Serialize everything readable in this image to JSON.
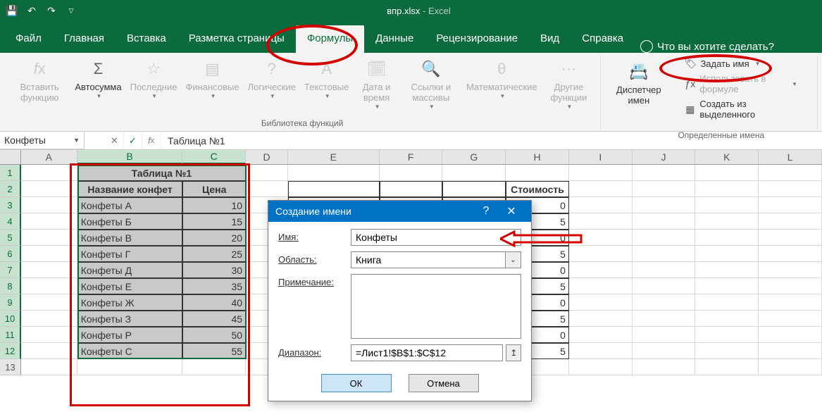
{
  "titlebar": {
    "filename": "впр.xlsx",
    "app": "Excel"
  },
  "tabs": {
    "items": [
      "Файл",
      "Главная",
      "Вставка",
      "Разметка страницы",
      "Формулы",
      "Данные",
      "Рецензирование",
      "Вид",
      "Справка"
    ],
    "active_index": 4,
    "search_placeholder": "Что вы хотите сделать?"
  },
  "ribbon": {
    "library_label": "Библиотека функций",
    "buttons": {
      "insert_fn": "Вставить функцию",
      "autosum": "Автосумма",
      "recent": "Последние",
      "financial": "Финансовые",
      "logical": "Логические",
      "text": "Текстовые",
      "datetime": "Дата и время",
      "lookup": "Ссылки и массивы",
      "math": "Математические",
      "other": "Другие функции",
      "name_mgr": "Диспетчер имен"
    },
    "names": {
      "define": "Задать имя",
      "use": "Использовать в формуле",
      "create": "Создать из выделенного",
      "group_label": "Определенные имена"
    }
  },
  "formula_bar": {
    "name": "Конфеты",
    "formula": "Таблица №1"
  },
  "columns": [
    "A",
    "B",
    "C",
    "D",
    "E",
    "F",
    "G",
    "H",
    "I",
    "J",
    "K",
    "L"
  ],
  "rows": [
    1,
    2,
    3,
    4,
    5,
    6,
    7,
    8,
    9,
    10,
    11,
    12,
    13
  ],
  "table1": {
    "title": "Таблица №1",
    "headers": [
      "Название конфет",
      "Цена"
    ],
    "rows": [
      [
        "Конфеты А",
        10
      ],
      [
        "Конфеты Б",
        15
      ],
      [
        "Конфеты В",
        20
      ],
      [
        "Конфеты Г",
        25
      ],
      [
        "Конфеты Д",
        30
      ],
      [
        "Конфеты Е",
        35
      ],
      [
        "Конфеты Ж",
        40
      ],
      [
        "Конфеты З",
        45
      ],
      [
        "Конфеты Р",
        50
      ],
      [
        "Конфеты С",
        55
      ]
    ]
  },
  "table2": {
    "headers": [
      "",
      "",
      "",
      "Стоимость"
    ],
    "rows": [
      0,
      5,
      0,
      5,
      0,
      5,
      0,
      5,
      0,
      5
    ]
  },
  "dialog": {
    "title": "Создание имени",
    "labels": {
      "name": "Имя:",
      "scope": "Область:",
      "comment": "Примечание:",
      "range": "Диапазон:"
    },
    "name_value": "Конфеты",
    "scope_value": "Книга",
    "comment_value": "",
    "range_value": "=Лист1!$B$1:$C$12",
    "ok": "ОК",
    "cancel": "Отмена",
    "help": "?",
    "close": "✕"
  }
}
